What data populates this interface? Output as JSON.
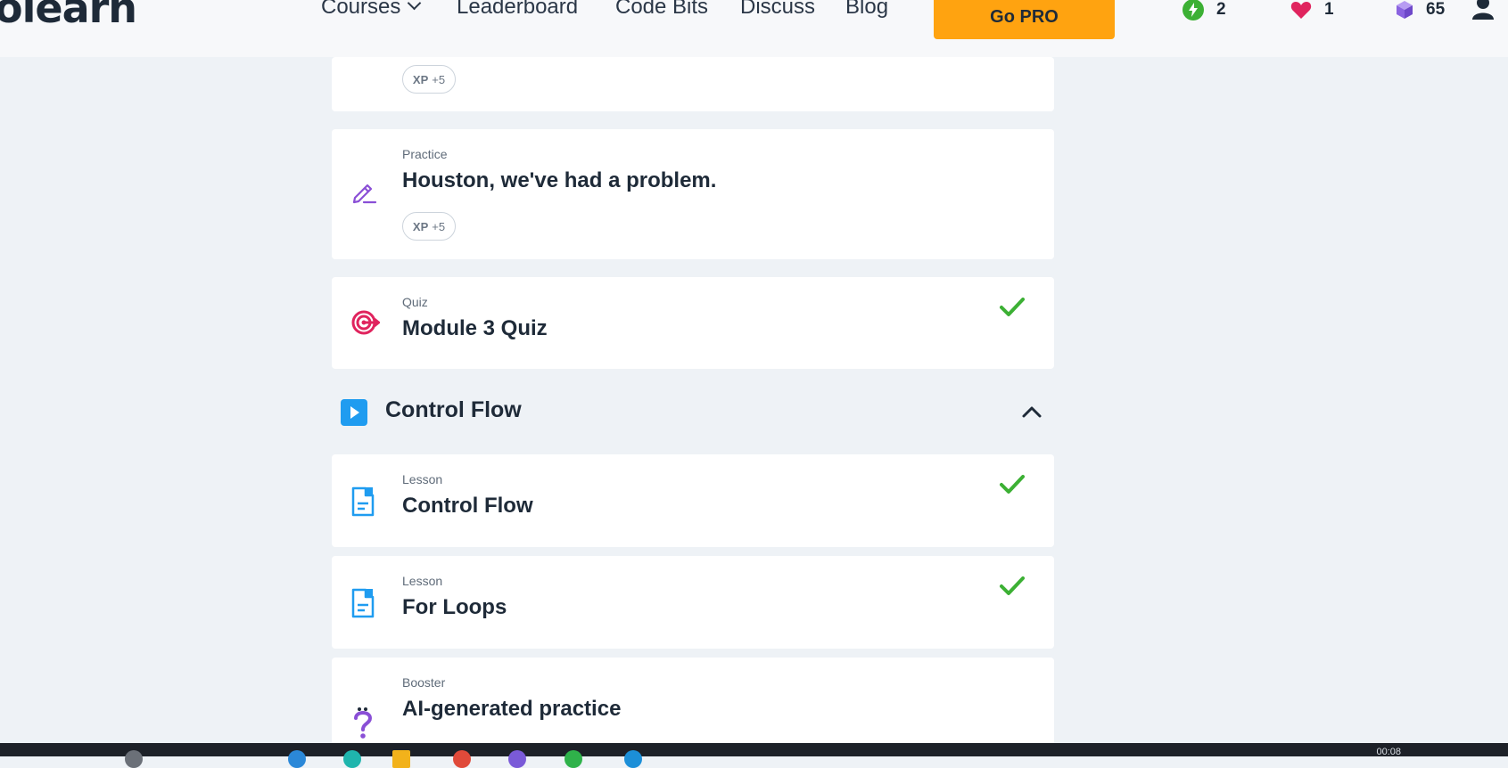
{
  "header": {
    "logo_text": "olearn",
    "nav": [
      {
        "label": "Courses"
      },
      {
        "label": "Leaderboard"
      },
      {
        "label": "Code Bits"
      },
      {
        "label": "Discuss"
      },
      {
        "label": "Blog"
      }
    ],
    "go_pro_label": "Go PRO",
    "stats": {
      "streak": "2",
      "hearts": "1",
      "gems": "65"
    }
  },
  "items": [
    {
      "type": "",
      "title": "",
      "xp_label": "XP",
      "xp_value": "+5",
      "icon": "none",
      "completed": false
    },
    {
      "type": "Practice",
      "title": "Houston, we've had a problem.",
      "xp_label": "XP",
      "xp_value": "+5",
      "icon": "pencil-icon",
      "completed": false
    },
    {
      "type": "Quiz",
      "title": "Module 3 Quiz",
      "icon": "target-icon",
      "completed": true
    }
  ],
  "section": {
    "title": "Control Flow",
    "expanded": true
  },
  "section_items": [
    {
      "type": "Lesson",
      "title": "Control Flow",
      "icon": "lesson-icon",
      "completed": true
    },
    {
      "type": "Lesson",
      "title": "For Loops",
      "icon": "lesson-icon",
      "completed": true
    },
    {
      "type": "Booster",
      "title": "AI-generated practice",
      "icon": "question-icon",
      "completed": false
    }
  ],
  "taskbar": {
    "clock": "00:08"
  },
  "colors": {
    "accent_pro": "#ffa310",
    "check_green": "#3cb034",
    "lesson_blue": "#1f9cf0",
    "practice_purple": "#8a4fd6",
    "quiz_pink": "#e0245e"
  }
}
